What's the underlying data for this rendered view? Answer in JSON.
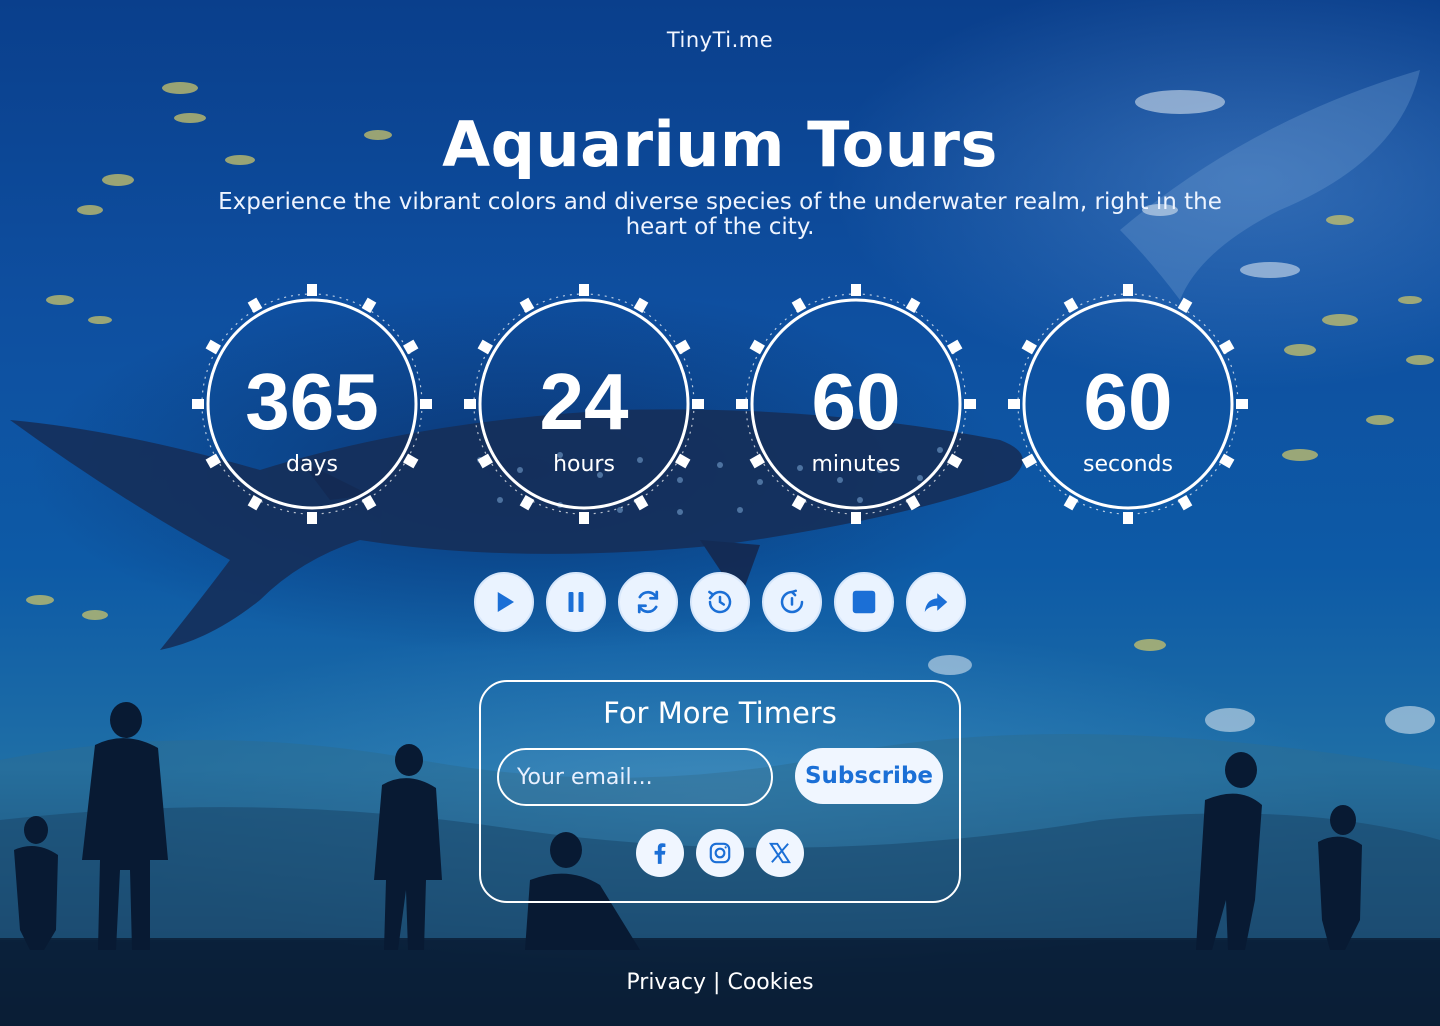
{
  "site": {
    "brand": "TinyTi.me"
  },
  "hero": {
    "title": "Aquarium Tours",
    "subtitle": "Experience the vibrant colors and diverse species of the underwater realm, right in the heart of the city."
  },
  "countdown": [
    {
      "value": "365",
      "unit": "days"
    },
    {
      "value": "24",
      "unit": "hours"
    },
    {
      "value": "60",
      "unit": "minutes"
    },
    {
      "value": "60",
      "unit": "seconds"
    }
  ],
  "controls": [
    "play-icon",
    "pause-icon",
    "refresh-icon",
    "history-icon",
    "timer-reset-icon",
    "stop-icon",
    "share-icon"
  ],
  "subscribe": {
    "title": "For More Timers",
    "email_placeholder": "Your email...",
    "button_label": "Subscribe",
    "social": [
      "facebook-icon",
      "instagram-icon",
      "x-icon"
    ]
  },
  "footer": {
    "privacy": "Privacy",
    "separator": "|",
    "cookies": "Cookies"
  },
  "colors": {
    "accent": "#1b6fd6",
    "button_bg": "#f0f6ff",
    "text": "#ffffff"
  }
}
